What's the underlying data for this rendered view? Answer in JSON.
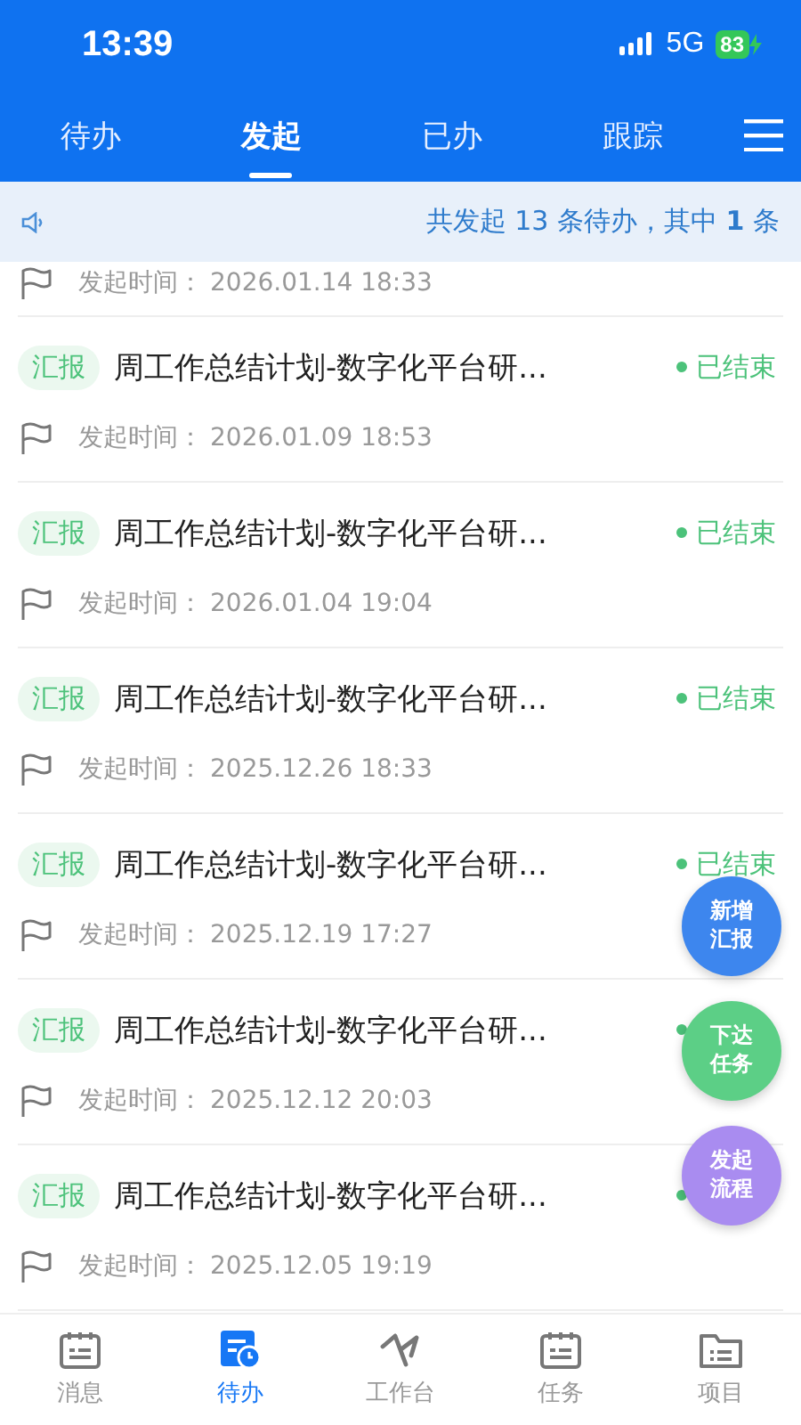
{
  "status_bar": {
    "time": "13:39",
    "network": "5G",
    "battery": "83"
  },
  "tabs": [
    {
      "label": "待办",
      "selected": false
    },
    {
      "label": "发起",
      "selected": true
    },
    {
      "label": "已办",
      "selected": false
    },
    {
      "label": "跟踪",
      "selected": false
    }
  ],
  "notice": "共发起 13 条待办，其中 **1** 条",
  "rows": [
    {
      "kind": "partial",
      "time_label": "发起时间：",
      "time": "2026.01.14 18:33"
    },
    {
      "kind": "full",
      "tag": "汇报",
      "title": "周工作总结计划-数字化平台研...",
      "status": "已结束",
      "time_label": "发起时间：",
      "time": "2026.01.09 18:53"
    },
    {
      "kind": "full",
      "tag": "汇报",
      "title": "周工作总结计划-数字化平台研...",
      "status": "已结束",
      "time_label": "发起时间：",
      "time": "2026.01.04 19:04"
    },
    {
      "kind": "full",
      "tag": "汇报",
      "title": "周工作总结计划-数字化平台研...",
      "status": "已结束",
      "time_label": "发起时间：",
      "time": "2025.12.26 18:33"
    },
    {
      "kind": "full",
      "tag": "汇报",
      "title": "周工作总结计划-数字化平台研...",
      "status": "已结束",
      "time_label": "发起时间：",
      "time": "2025.12.19 17:27"
    },
    {
      "kind": "full",
      "tag": "汇报",
      "title": "周工作总结计划-数字化平台研...",
      "time_label": "发起时间：",
      "time": "2025.12.12 20:03"
    },
    {
      "kind": "full",
      "tag": "汇报",
      "title": "周工作总结计划-数字化平台研...",
      "time_label": "发起时间：",
      "time": "2025.12.05 19:19"
    }
  ],
  "fabs": [
    {
      "label": "新增汇报",
      "color": "#3d86ee"
    },
    {
      "label": "下达任务",
      "color": "#5ccf86"
    },
    {
      "label": "发起流程",
      "color": "#a98cf0"
    }
  ],
  "bottom_nav": [
    {
      "label": "消息",
      "selected": false
    },
    {
      "label": "待办",
      "selected": true
    },
    {
      "label": "工作台",
      "selected": false
    },
    {
      "label": "任务",
      "selected": false
    },
    {
      "label": "项目",
      "selected": false
    }
  ]
}
